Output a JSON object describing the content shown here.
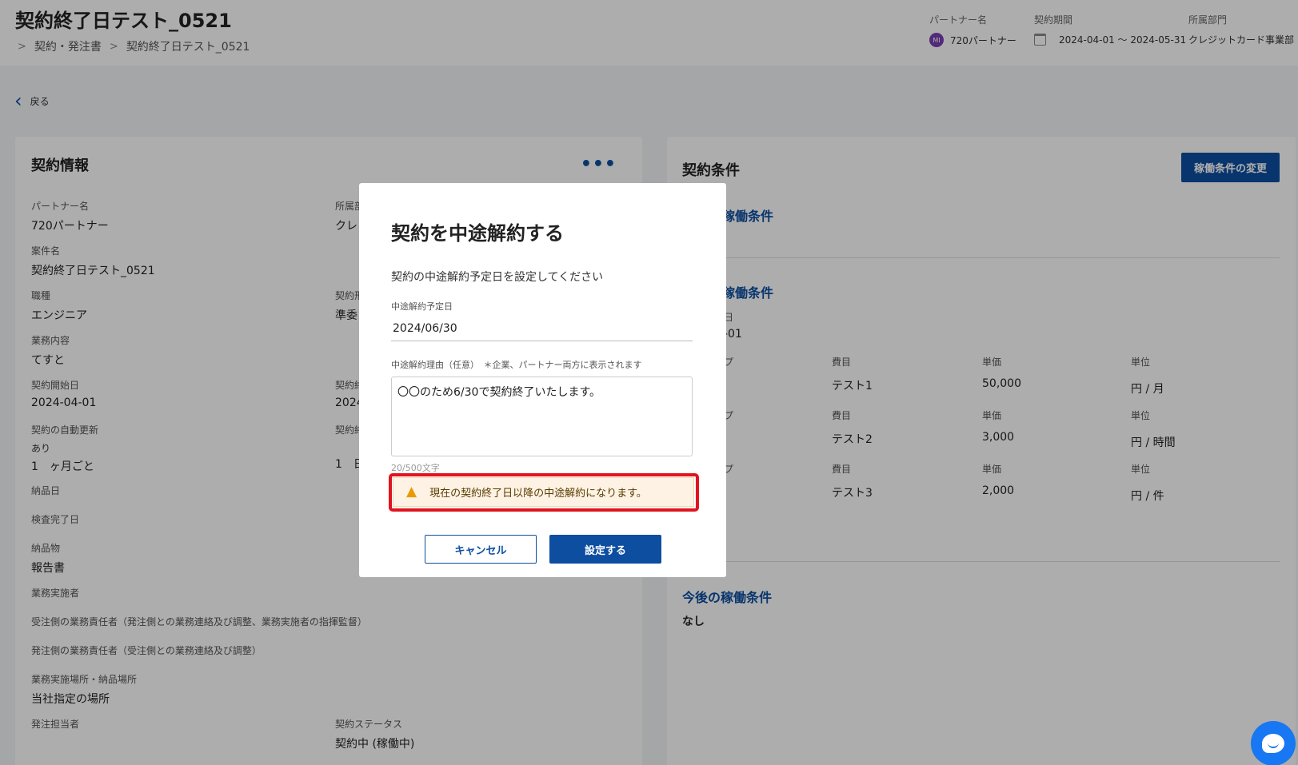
{
  "header": {
    "title": "契約終了日テスト_0521",
    "breadcrumb": [
      "契約・発注書",
      "契約終了日テスト_0521"
    ],
    "partner_label": "パートナー名",
    "partner_avatar": "MI",
    "partner_value": "720パートナー",
    "period_label": "契約期間",
    "period_value": "2024-04-01 〜 2024-05-31",
    "dept_label": "所属部門",
    "dept_value": "クレジットカード事業部"
  },
  "back_label": "戻る",
  "left_card": {
    "title": "契約情報",
    "fields": [
      {
        "label": "パートナー名",
        "value": "720パートナー"
      },
      {
        "label": "所属部",
        "value": "クレ"
      },
      {
        "label": "案件名",
        "value": "契約終了日テスト_0521"
      },
      {
        "label": "職種",
        "value": "エンジニア"
      },
      {
        "label": "契約形",
        "value": "準委"
      },
      {
        "label": "業務内容",
        "value": "てすと"
      },
      {
        "label": "契約開始日",
        "value": "2024-04-01"
      },
      {
        "label": "契約終",
        "value": "2024"
      },
      {
        "label": "契約の自動更新",
        "sub": "あり",
        "value": "1　ヶ月ごと"
      },
      {
        "label": "契約終",
        "value": "1　日"
      },
      {
        "label": "納品日",
        "value": ""
      },
      {
        "label": "検査完了日",
        "value": ""
      },
      {
        "label": "納品物",
        "value": "報告書"
      },
      {
        "label": "業務実施者",
        "value": ""
      },
      {
        "label": "受注側の業務責任者（発注側との業務連絡及び調整、業務実施者の指揮監督）",
        "value": ""
      },
      {
        "label": "発注側の業務責任者（受注側との業務連絡及び調整）",
        "value": ""
      },
      {
        "label": "業務実施場所・納品場所",
        "value": "当社指定の場所"
      },
      {
        "label": "発注担当者",
        "value": ""
      },
      {
        "label": "契約ステータス",
        "value": "契約中 (稼働中)"
      }
    ]
  },
  "right_card": {
    "title": "契約条件",
    "change_button": "稼働条件の変更",
    "section1": "稼働条件",
    "section2": "稼働条件",
    "date_label": "日",
    "date_value": "-01",
    "col_type": "プ",
    "col_item": "費目",
    "col_price": "単価",
    "col_unit": "単位",
    "rows": [
      {
        "type": "",
        "item": "テスト1",
        "price": "50,000",
        "unit": "円 / 月"
      },
      {
        "type": "",
        "item": "テスト2",
        "price": "3,000",
        "unit": "円 / 時間"
      },
      {
        "type": "",
        "item": "テスト3",
        "price": "2,000",
        "unit": "円 / 件"
      }
    ],
    "future_title": "今後の稼働条件",
    "future_value": "なし"
  },
  "modal": {
    "title": "契約を中途解約する",
    "description": "契約の中途解約予定日を設定してください",
    "date_label": "中途解約予定日",
    "date_value": "2024/06/30",
    "reason_label": "中途解約理由（任意）　＊企業、パートナー両方に表示されます",
    "reason_value": "〇〇のため6/30で契約終了いたします。",
    "char_count": "20/500文字",
    "warning": "現在の契約終了日以降の中途解約になります。",
    "cancel_label": "キャンセル",
    "submit_label": "設定する"
  },
  "colors": {
    "primary": "#0d4ea1",
    "warning_bg": "#fdf2e3",
    "highlight": "#e0141e",
    "chat": "#1877f2"
  }
}
